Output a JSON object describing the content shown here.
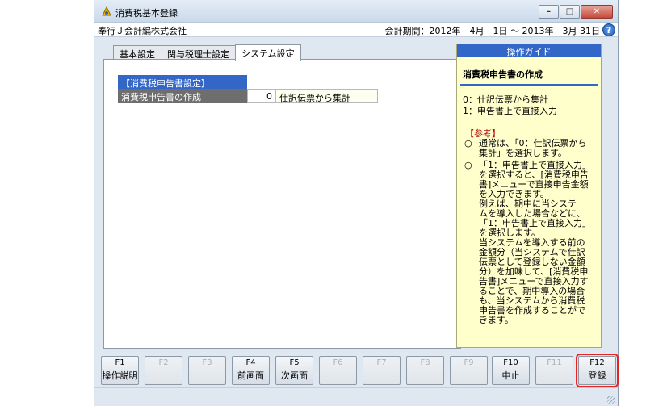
{
  "window": {
    "title": "消費税基本登録",
    "buttons": {
      "minimize": "–",
      "maximize": "□",
      "close": "✕"
    }
  },
  "info": {
    "company": "奉行Ｊ会計編株式会社",
    "period": "会計期間：2012年　4月　1日 ～ 2013年　3月 31日",
    "help_glyph": "?"
  },
  "tabs": [
    {
      "label": "基本設定",
      "active": false
    },
    {
      "label": "関与税理士設定",
      "active": false
    },
    {
      "label": "システム設定",
      "active": true
    }
  ],
  "section": {
    "header": "【消費税申告書設定】",
    "rows": [
      {
        "label": "消費税申告書の作成",
        "value": "0",
        "description": "仕訳伝票から集計"
      }
    ]
  },
  "guide": {
    "header": "操作ガイド",
    "title": "消費税申告書の作成",
    "options": [
      "0：仕訳伝票から集計",
      "1：申告書上で直接入力"
    ],
    "ref_title": "【参考】",
    "notes": [
      {
        "bullet": "○",
        "lines": [
          "通常は、「0：仕訳伝票から",
          "集計」を選択します。"
        ]
      },
      {
        "bullet": "○",
        "lines": [
          "「1：申告書上で直接入力」",
          "を選択すると、[消費税申告",
          "書]メニューで直接申告金額",
          "を入力できます。",
          "例えば、期中に当システ",
          "ムを導入した場合などに、",
          "「1：申告書上で直接入力」",
          "を選択します。",
          "当システムを導入する前の",
          "金額分（当システムで仕訳",
          "伝票として登録しない金額",
          "分）を加味して、[消費税申",
          "告書]メニューで直接入力す",
          "ることで、期中導入の場合",
          "も、当システムから消費税",
          "申告書を作成することがで",
          "きます。"
        ]
      }
    ]
  },
  "fkeys": [
    {
      "code": "F1",
      "name": "操作説明",
      "enabled": true
    },
    {
      "code": "F2",
      "name": "",
      "enabled": false
    },
    {
      "code": "F3",
      "name": "",
      "enabled": false
    },
    {
      "code": "F4",
      "name": "前画面",
      "enabled": true
    },
    {
      "code": "F5",
      "name": "次画面",
      "enabled": true
    },
    {
      "code": "F6",
      "name": "",
      "enabled": false
    },
    {
      "code": "F7",
      "name": "",
      "enabled": false
    },
    {
      "code": "F8",
      "name": "",
      "enabled": false
    },
    {
      "code": "F9",
      "name": "",
      "enabled": false
    },
    {
      "code": "F10",
      "name": "中止",
      "enabled": true
    },
    {
      "code": "F11",
      "name": "",
      "enabled": false
    },
    {
      "code": "F12",
      "name": "登録",
      "enabled": true
    }
  ]
}
